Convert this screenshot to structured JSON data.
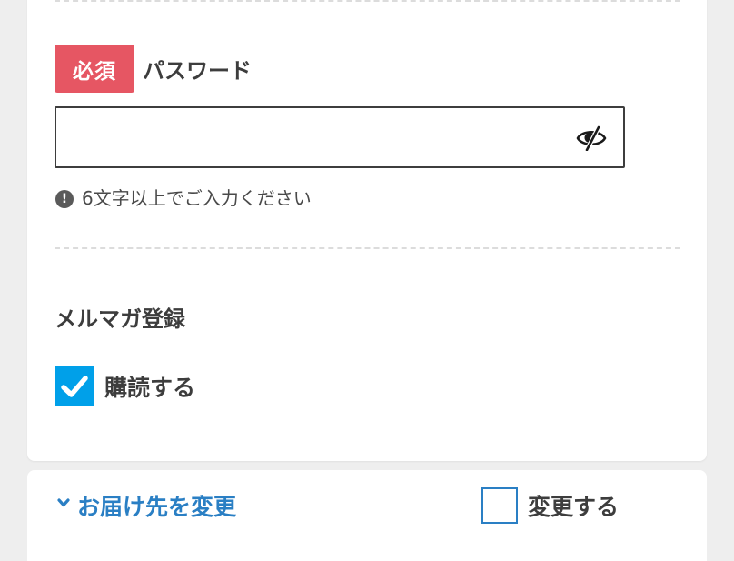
{
  "password_section": {
    "required_badge": "必須",
    "label": "パスワード",
    "input_value": "",
    "input_placeholder": "",
    "hint": "6文字以上でご入力ください",
    "hint_icon_glyph": "!"
  },
  "newsletter_section": {
    "title": "メルマガ登録",
    "subscribe_label": "購読する",
    "subscribe_checked": true
  },
  "delivery_section": {
    "change_link": "お届け先を変更",
    "change_checkbox_label": "変更する",
    "change_checked": false
  },
  "icons": {
    "eye": "eye-slash-icon",
    "hint": "exclamation-circle-icon",
    "check": "checkmark-icon",
    "chevron": "chevron-down-icon"
  },
  "colors": {
    "required_badge": "#e65663",
    "checkbox_checked": "#00a0e9",
    "link": "#2a7fc4",
    "text": "#3d3d3d",
    "background": "#eeeeee"
  }
}
